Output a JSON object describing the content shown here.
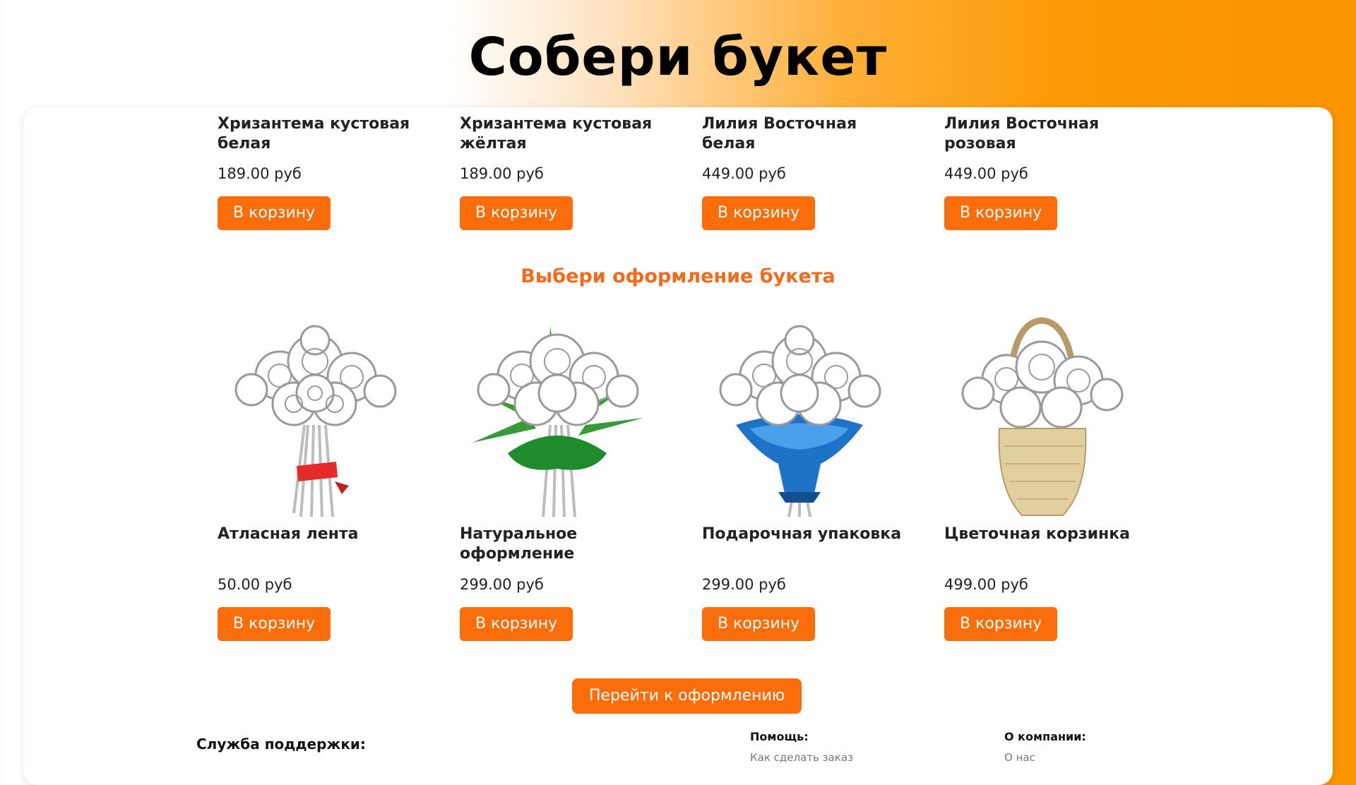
{
  "slide_title": "Собери букет",
  "section_title": "Выбери оформление букета",
  "cart_label": "В корзину",
  "flowers": [
    {
      "name": "Хризантема кустовая белая",
      "price": "189.00 руб"
    },
    {
      "name": "Хризантема кустовая жёлтая",
      "price": "189.00 руб"
    },
    {
      "name": "Лилия Восточная белая",
      "price": "449.00 руб"
    },
    {
      "name": "Лилия Восточная розовая",
      "price": "449.00 руб"
    }
  ],
  "decorations": [
    {
      "name": "Атласная лента",
      "price": "50.00 руб",
      "image": "bouquet-satin-ribbon"
    },
    {
      "name": "Натуральное оформление",
      "price": "299.00 руб",
      "image": "bouquet-natural-greenery"
    },
    {
      "name": "Подарочная упаковка",
      "price": "299.00 руб",
      "image": "bouquet-gift-wrap"
    },
    {
      "name": "Цветочная корзинка",
      "price": "499.00 руб",
      "image": "bouquet-basket"
    }
  ],
  "checkout_label": "Перейти к оформлению",
  "footer": {
    "support_title": "Служба поддержки:",
    "help_title": "Помощь:",
    "help_link": "Как сделать заказ",
    "company_title": "О компании:",
    "company_link": "О нас"
  },
  "colors": {
    "accent": "#fb6d0a",
    "section_title": "#f26a1b",
    "gradient_end": "#fa9400"
  }
}
